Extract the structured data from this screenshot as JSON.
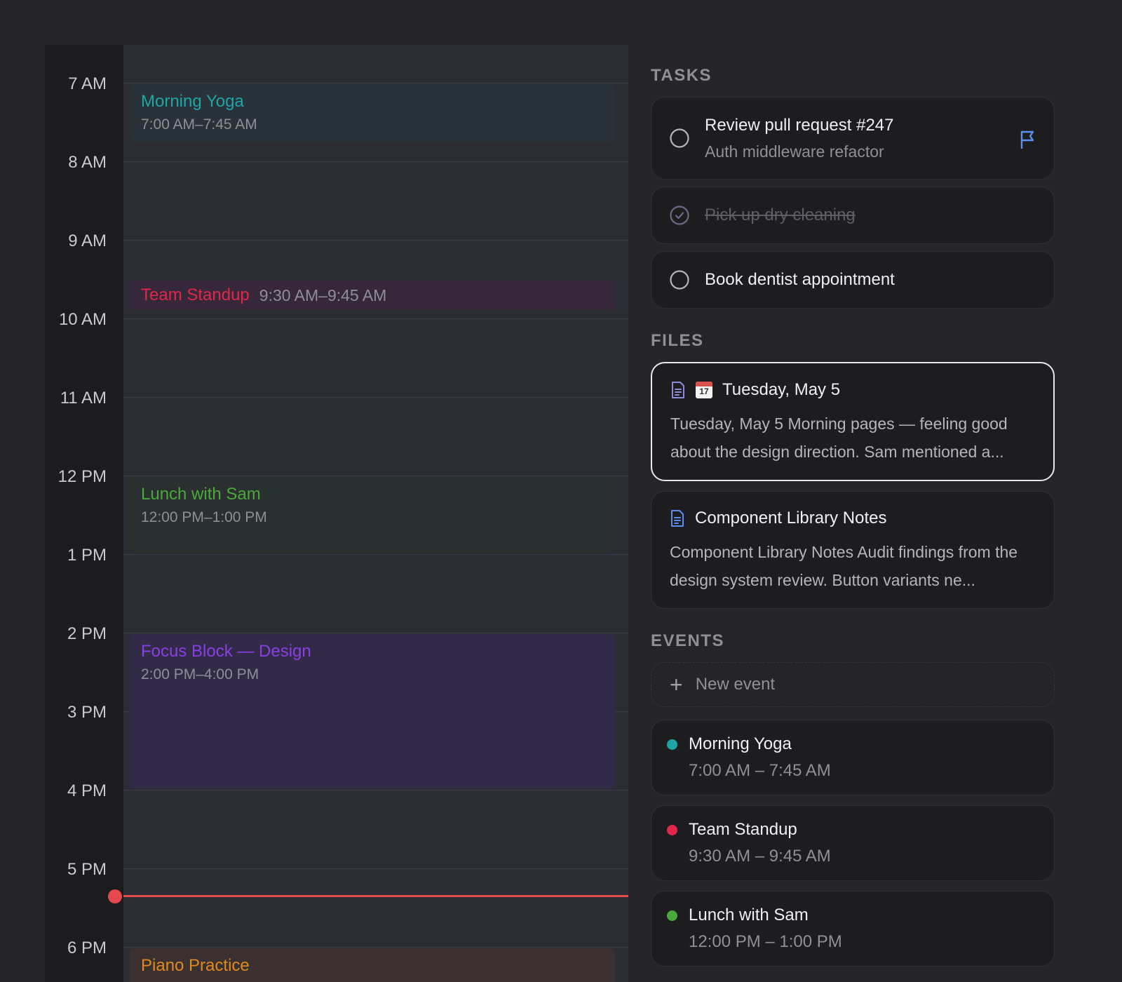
{
  "calendar": {
    "hours": [
      "7 AM",
      "8 AM",
      "9 AM",
      "10 AM",
      "11 AM",
      "12 PM",
      "1 PM",
      "2 PM",
      "3 PM",
      "4 PM",
      "5 PM",
      "6 PM"
    ],
    "events": [
      {
        "title": "Morning Yoga",
        "time": "7:00 AM–7:45 AM",
        "color": "#1fa5a5"
      },
      {
        "title": "Team Standup",
        "time": "9:30 AM–9:45 AM",
        "color": "#e0264a"
      },
      {
        "title": "Lunch with Sam",
        "time": "12:00 PM–1:00 PM",
        "color": "#4aa83c"
      },
      {
        "title": "Focus Block — Design",
        "time": "2:00 PM–4:00 PM",
        "color": "#8b3ee6"
      },
      {
        "title": "Piano Practice",
        "color": "#e08a1e"
      }
    ]
  },
  "tasks": {
    "title": "TASKS",
    "items": [
      {
        "title": "Review pull request #247",
        "subtitle": "Auth middleware refactor",
        "flagged": true,
        "done": false
      },
      {
        "title": "Pick up dry cleaning",
        "done": true
      },
      {
        "title": "Book dentist appointment",
        "done": false
      }
    ]
  },
  "files": {
    "title": "FILES",
    "items": [
      {
        "calendar_day": "17",
        "title": "Tuesday, May 5",
        "preview": "Tuesday, May 5 Morning pages — feeling good about the design direction. Sam mentioned a..."
      },
      {
        "title": "Component Library Notes",
        "preview": "Component Library Notes Audit findings from the design system review. Button variants ne..."
      }
    ]
  },
  "events_panel": {
    "title": "EVENTS",
    "new_label": "New event",
    "items": [
      {
        "title": "Morning Yoga",
        "time": "7:00 AM – 7:45 AM",
        "color": "#1fa5a5"
      },
      {
        "title": "Team Standup",
        "time": "9:30 AM – 9:45 AM",
        "color": "#e0264a"
      },
      {
        "title": "Lunch with Sam",
        "time": "12:00 PM – 1:00 PM",
        "color": "#4aa83c"
      }
    ]
  }
}
